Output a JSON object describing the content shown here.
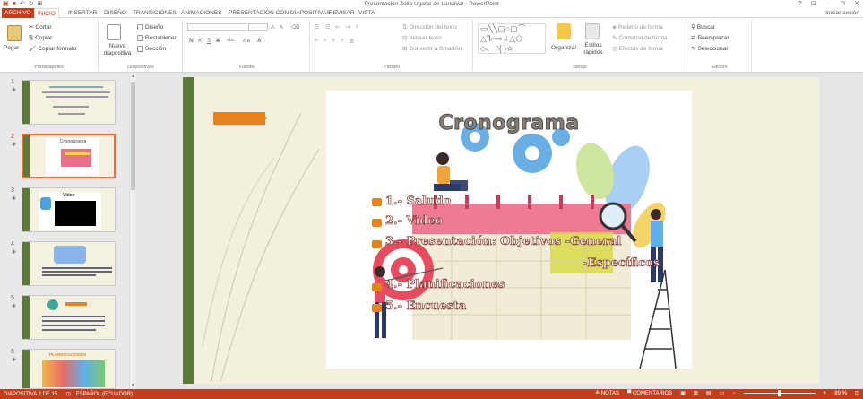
{
  "window": {
    "title": "Presentación Zoila Ugarte de Landívar - PowerPoint",
    "controls": [
      "?",
      "⊡",
      "—",
      "⊓",
      "✕"
    ],
    "signin": "Iniciar sesión"
  },
  "tabs": [
    {
      "label": "ARCHIVO"
    },
    {
      "label": "INICIO"
    },
    {
      "label": "INSERTAR"
    },
    {
      "label": "DISEÑO"
    },
    {
      "label": "TRANSICIONES"
    },
    {
      "label": "ANIMACIONES"
    },
    {
      "label": "PRESENTACIÓN CON DIAPOSITIVAS"
    },
    {
      "label": "REVISAR"
    },
    {
      "label": "VISTA"
    }
  ],
  "ribbon": {
    "clipboard": {
      "paste": "Pegar",
      "cut": "Cortar",
      "copy": "Copiar",
      "format_painter": "Copiar formato",
      "label": "Portapapeles"
    },
    "slides": {
      "new_slide": "Nueva diapositiva",
      "layout": "Diseño",
      "reset": "Restablecer",
      "section": "Sección",
      "label": "Diapositivas"
    },
    "font": {
      "label": "Fuente",
      "bold": "N",
      "italic": "K",
      "underline": "S",
      "strike": "S",
      "spacing": "abc",
      "case": "Aa",
      "size_up": "A",
      "size_down": "A"
    },
    "paragraph": {
      "label": "Párrafo",
      "text_direction": "Dirección del texto",
      "align_text": "Alinear texto",
      "smartart": "Convertir a SmartArt"
    },
    "drawing": {
      "label": "Dibujo",
      "arrange": "Organizar",
      "styles": "Estilos rápidos",
      "fill": "Relleno de forma",
      "outline": "Contorno de forma",
      "effects": "Efectos de forma"
    },
    "editing": {
      "label": "Edición",
      "find": "Buscar",
      "replace": "Reemplazar",
      "select": "Seleccionar"
    }
  },
  "thumbnails": [
    {
      "num": "1",
      "title": ""
    },
    {
      "num": "2",
      "title": "Cronograma"
    },
    {
      "num": "3",
      "title": "Video"
    },
    {
      "num": "4",
      "title": ""
    },
    {
      "num": "5",
      "title": ""
    },
    {
      "num": "6",
      "title": "PLANIFICACIONES"
    }
  ],
  "slide": {
    "title": "Cronograma",
    "items": [
      "1.- Saludo",
      "2.- Video",
      "3.-  Presentación: Objetivos -General",
      "-Específicos",
      "4.- Planificaciones",
      "5.- Encuesta"
    ]
  },
  "status": {
    "slide_info": "DIAPOSITIVA 2 DE 15",
    "language": "ESPAÑOL (ECUADOR)",
    "notes": "NOTAS",
    "comments": "COMENTARIOS",
    "zoom": "89 %"
  },
  "colors": {
    "accent": "#c43e1c",
    "orange": "#e8821e",
    "green": "#5b7a3a"
  }
}
